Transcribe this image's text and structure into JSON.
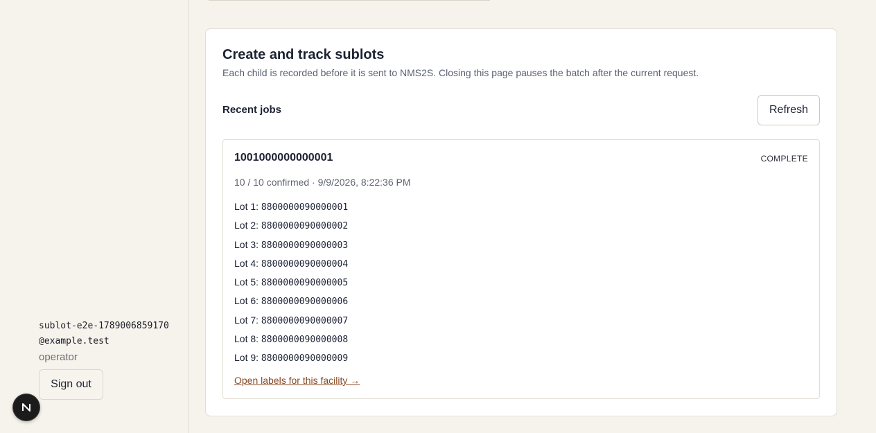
{
  "sidebar": {
    "user_email": "sublot-e2e-1789006859170@example.test",
    "user_role": "operator",
    "sign_out_label": "Sign out",
    "badge_letter": "N"
  },
  "main": {
    "title": "Create and track sublots",
    "subtitle": "Each child is recorded before it is sent to NMS2S. Closing this page pauses the batch after the current request.",
    "recent_jobs_label": "Recent jobs",
    "refresh_label": "Refresh",
    "jobs": [
      {
        "id": "1001000000000001",
        "status": "COMPLETE",
        "meta": "10 / 10 confirmed · 9/9/2026, 8:22:36 PM",
        "lots": [
          {
            "label": "Lot 1:",
            "code": "8800000090000001"
          },
          {
            "label": "Lot 2:",
            "code": "8800000090000002"
          },
          {
            "label": "Lot 3:",
            "code": "8800000090000003"
          },
          {
            "label": "Lot 4:",
            "code": "8800000090000004"
          },
          {
            "label": "Lot 5:",
            "code": "8800000090000005"
          },
          {
            "label": "Lot 6:",
            "code": "8800000090000006"
          },
          {
            "label": "Lot 7:",
            "code": "8800000090000007"
          },
          {
            "label": "Lot 8:",
            "code": "8800000090000008"
          },
          {
            "label": "Lot 9:",
            "code": "8800000090000009"
          }
        ],
        "labels_link": "Open labels for this facility →"
      }
    ]
  },
  "colors": {
    "page_bg": "#f6f3ec",
    "card_bg": "#ffffff",
    "link": "#8a4b24",
    "border": "#e3ddd1"
  }
}
